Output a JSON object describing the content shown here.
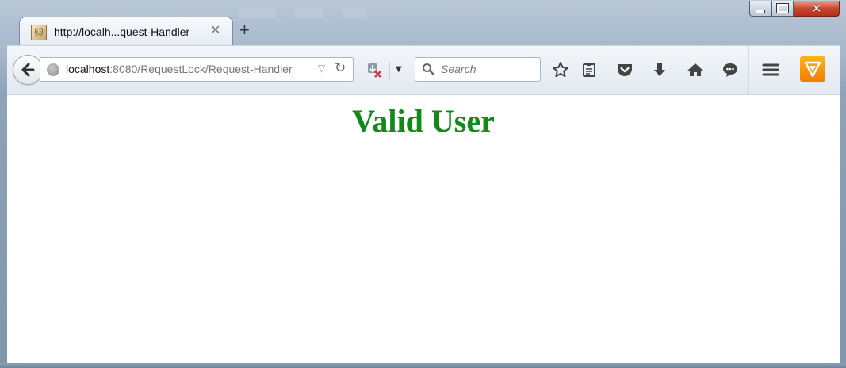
{
  "browser": {
    "tab": {
      "title": "http://localh...quest-Handler",
      "close_glyph": "✕",
      "favicon_icon": "tomcat-favicon-icon"
    },
    "new_tab_glyph": "+",
    "window_controls": {
      "minimize_icon": "minimize-icon",
      "maximize_icon": "maximize-icon",
      "close_glyph": "✕"
    },
    "address_bar": {
      "host": "localhost",
      "path": ":8080/RequestLock/Request-Handler",
      "dropdown_glyph": "▽",
      "reload_glyph": "↻"
    },
    "search": {
      "placeholder": "Search"
    },
    "toolbar_icons": [
      "bookmark-star-icon",
      "reading-list-icon",
      "pocket-icon",
      "download-icon",
      "home-icon",
      "chat-icon",
      "menu-icon",
      "brand-extension-icon"
    ],
    "menu_dropdown_glyph": "▼",
    "colors": {
      "heading": "#118a1a",
      "brand_orange": "#f39200"
    }
  },
  "page": {
    "heading": "Valid User"
  }
}
